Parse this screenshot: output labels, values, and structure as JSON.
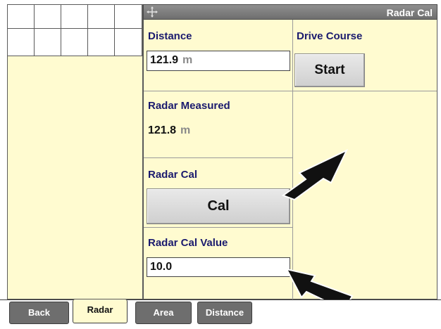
{
  "header": {
    "title": "Radar Cal",
    "move_icon": "crosshair-icon"
  },
  "distance": {
    "label": "Distance",
    "value": "121.9",
    "unit": "m"
  },
  "drive_course": {
    "label": "Drive Course",
    "button": "Start"
  },
  "radar_measured": {
    "label": "Radar Measured",
    "value": "121.8",
    "unit": "m"
  },
  "radar_cal": {
    "label": "Radar Cal",
    "button": "Cal"
  },
  "radar_cal_value": {
    "label": "Radar Cal Value",
    "value": "10.0"
  },
  "tabs": [
    {
      "label": "Back"
    },
    {
      "label": "Radar"
    },
    {
      "label": "Area"
    },
    {
      "label": "Distance"
    }
  ],
  "colors": {
    "panel_bg": "#fffbd0",
    "label_blue": "#1a1a6e",
    "titlebar": "#7a7a7a"
  }
}
